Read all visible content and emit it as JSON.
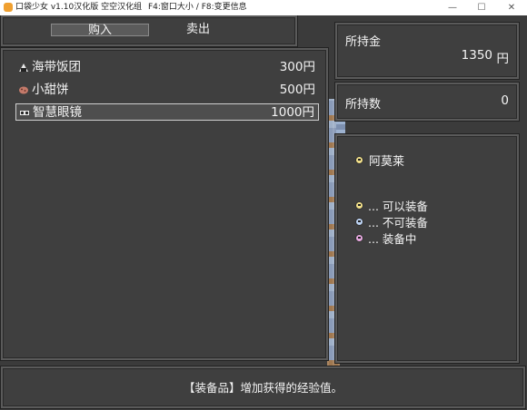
{
  "window": {
    "title": "口袋少女 v1.10汉化版  空空汉化组",
    "hint": "F4:窗口大小 / F8:变更信息",
    "controls": [
      "—",
      "☐",
      "✕"
    ]
  },
  "commands": {
    "buy": "购入",
    "sell": "卖出"
  },
  "items": [
    {
      "name": "海带饭团",
      "price": "300円",
      "icon": "rice-ball-icon",
      "color": "#e6e6e6"
    },
    {
      "name": "小甜饼",
      "price": "500円",
      "icon": "cookie-icon",
      "color": "#c47a6a"
    },
    {
      "name": "智慧眼镜",
      "price": "1000円",
      "icon": "glasses-icon",
      "color": "#222222"
    }
  ],
  "gold": {
    "label": "所持金",
    "value": "1350",
    "unit": "円"
  },
  "owned": {
    "label": "所持数",
    "value": "0"
  },
  "party": {
    "member": "阿莫莱",
    "legend": [
      {
        "text": "... 可以装备",
        "icon": "happy-face-icon",
        "color": "#f2e08a"
      },
      {
        "text": "... 不可装备",
        "icon": "sad-face-icon",
        "color": "#bcd2f2"
      },
      {
        "text": "... 装备中",
        "icon": "equipped-face-icon",
        "color": "#e7a9e0"
      }
    ]
  },
  "help": "【装备品】增加获得的经验值。",
  "colors": {
    "window_bg": "#3f3f3f",
    "border": "#5a5a5a"
  }
}
